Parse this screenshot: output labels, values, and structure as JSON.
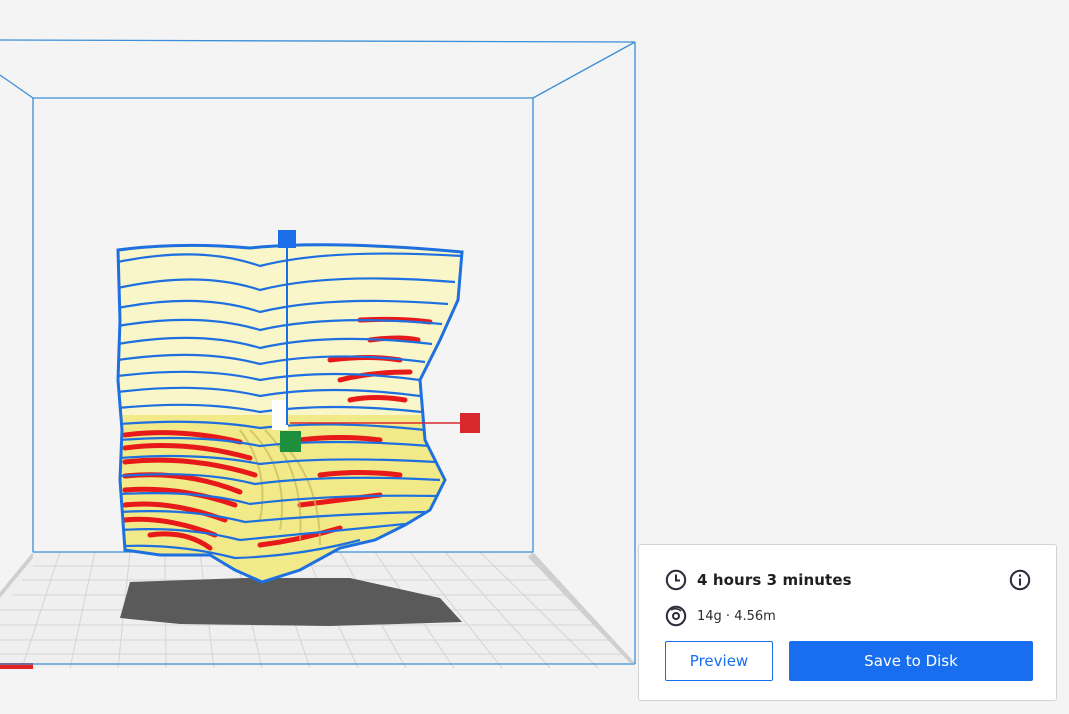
{
  "print_summary": {
    "print_time": "4 hours 3 minutes",
    "material_usage": "14g · 4.56m",
    "preview_label": "Preview",
    "save_label": "Save to Disk",
    "icons": {
      "time": "clock-icon",
      "material": "spool-icon",
      "info": "info-icon"
    }
  },
  "viewport": {
    "colors": {
      "background": "#f4f4f4",
      "build_volume_outline": "#3b8fd8",
      "model_shell": "#1e6fe0",
      "model_infill": "#f2ea88",
      "overhang": "#ee1c1c",
      "shadow": "#5a5a5a",
      "plate": "#efefef",
      "axis_x": "#d9272e",
      "axis_y": "#1e8f3c",
      "axis_z": "#1a6fe8"
    },
    "icons": {
      "x_handle": "x-axis-handle",
      "y_handle": "y-axis-handle",
      "z_handle": "z-axis-handle"
    }
  },
  "accent_color": "#196ef0"
}
